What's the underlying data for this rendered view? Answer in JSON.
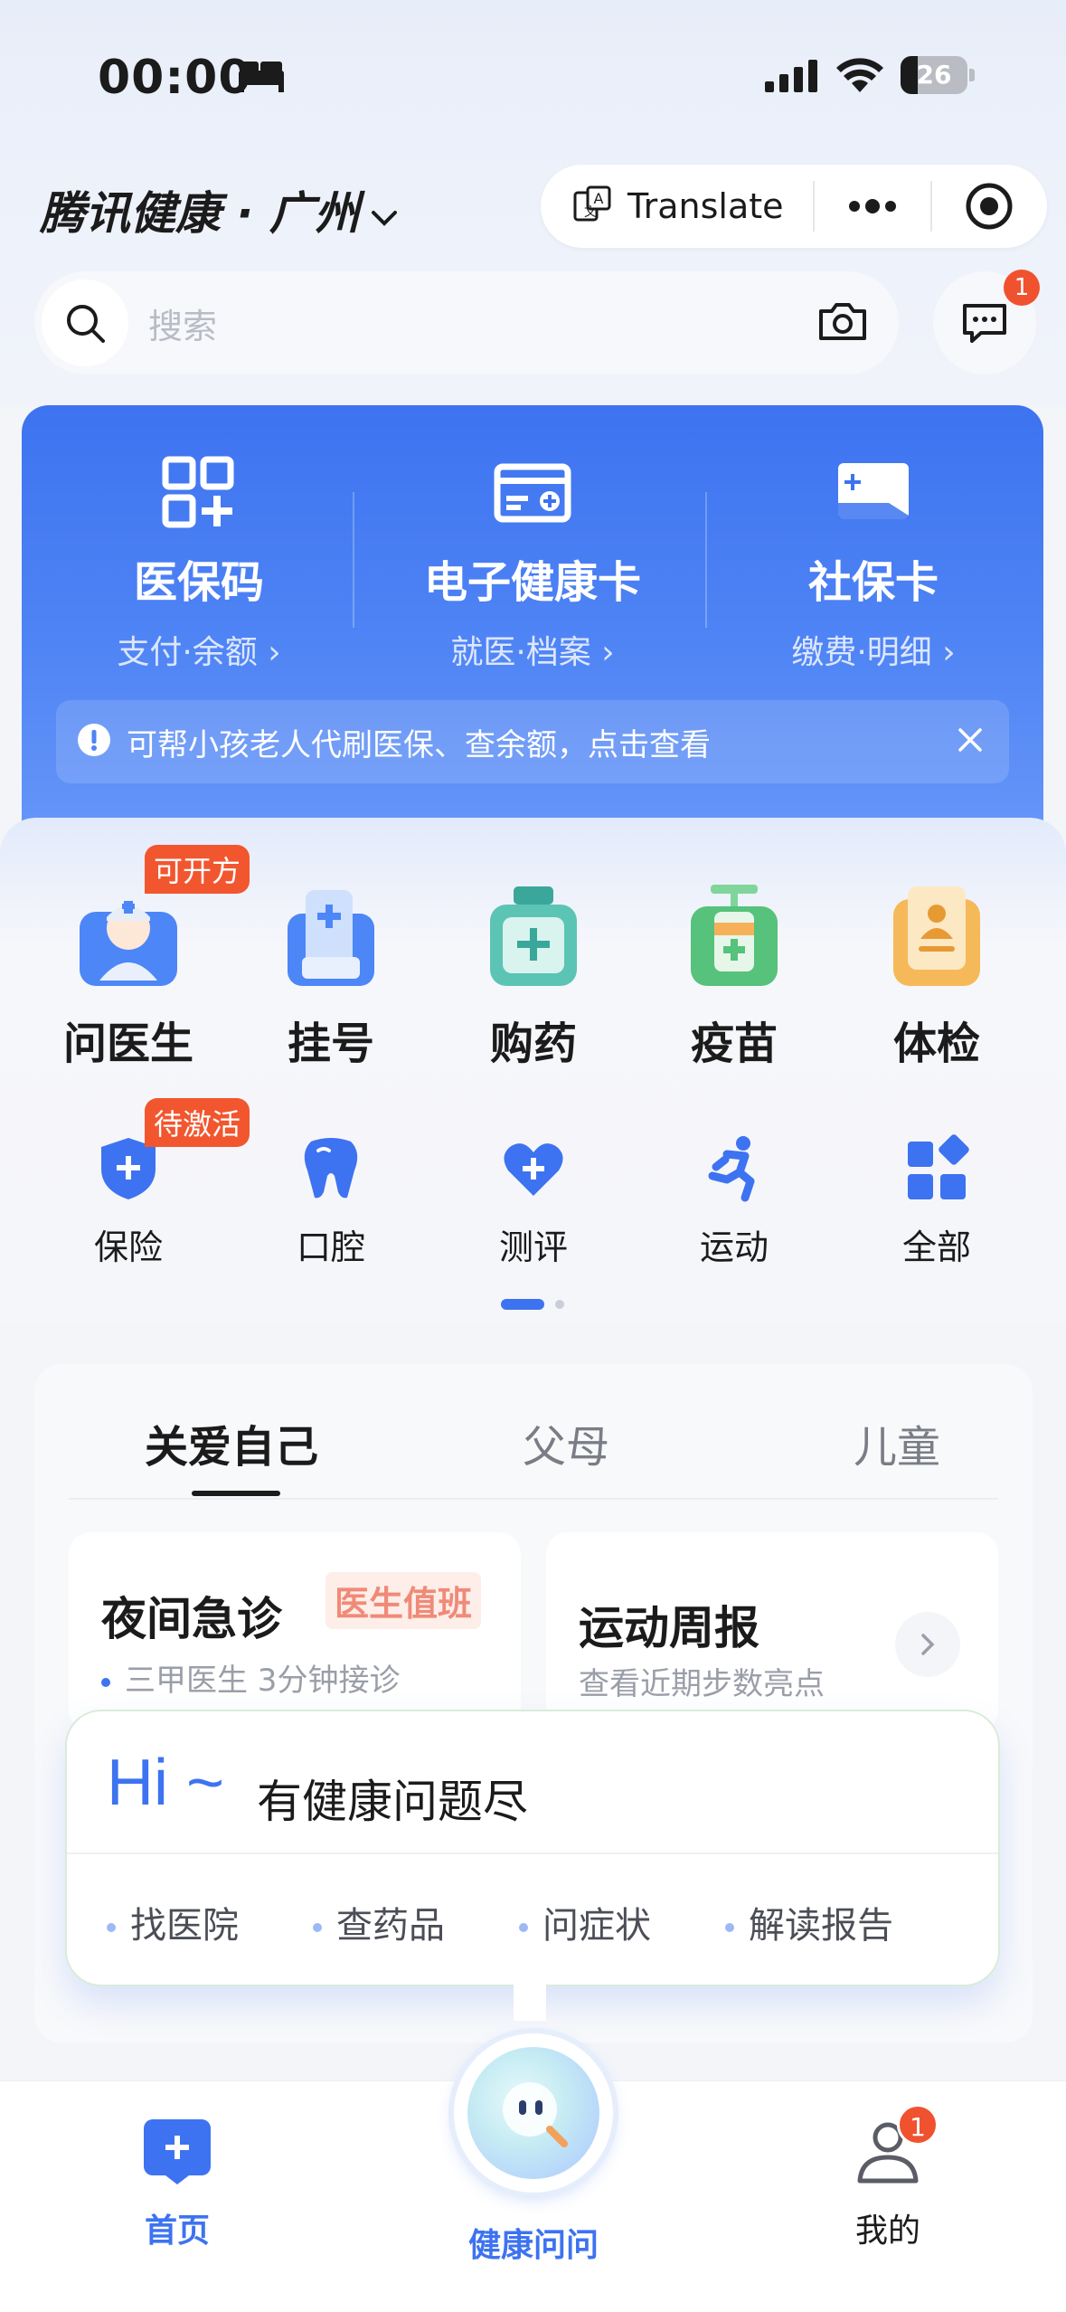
{
  "status_bar": {
    "time": "00:00",
    "battery": "26",
    "battery_level": 0.26
  },
  "header": {
    "app_title": "腾讯健康 · 广州",
    "translate_label": "Translate"
  },
  "search": {
    "placeholder": "搜索",
    "message_badge": "1"
  },
  "cards": [
    {
      "title": "医保码",
      "subtitle": "支付·余额 ›"
    },
    {
      "title": "电子健康卡",
      "subtitle": "就医·档案 ›"
    },
    {
      "title": "社保卡",
      "subtitle": "缴费·明细 ›"
    }
  ],
  "notice": {
    "text": "可帮小孩老人代刷医保、查余额，点击查看"
  },
  "services_primary": [
    {
      "label": "问医生",
      "tag": "可开方"
    },
    {
      "label": "挂号"
    },
    {
      "label": "购药"
    },
    {
      "label": "疫苗"
    },
    {
      "label": "体检"
    }
  ],
  "services_secondary": [
    {
      "label": "保险",
      "tag": "待激活"
    },
    {
      "label": "口腔"
    },
    {
      "label": "测评"
    },
    {
      "label": "运动"
    },
    {
      "label": "全部"
    }
  ],
  "care": {
    "tabs": [
      "关爱自己",
      "父母",
      "儿童"
    ],
    "night_card": {
      "title": "夜间急诊",
      "tag": "医生值班",
      "sub": "三甲医生 3分钟接诊"
    },
    "sport_card": {
      "title": "运动周报",
      "sub": "查看近期步数亮点"
    }
  },
  "ai_popup": {
    "hi": "Hi ~",
    "question": "有健康问题尽",
    "chips": [
      "找医院",
      "查药品",
      "问症状",
      "解读报告"
    ]
  },
  "tabbar": {
    "home": "首页",
    "ai": "健康问问",
    "me": "我的",
    "me_badge": "1",
    "active_color": "#3d73f0"
  },
  "colors": {
    "accent": "#3d73f0",
    "badge": "#f0522f"
  }
}
